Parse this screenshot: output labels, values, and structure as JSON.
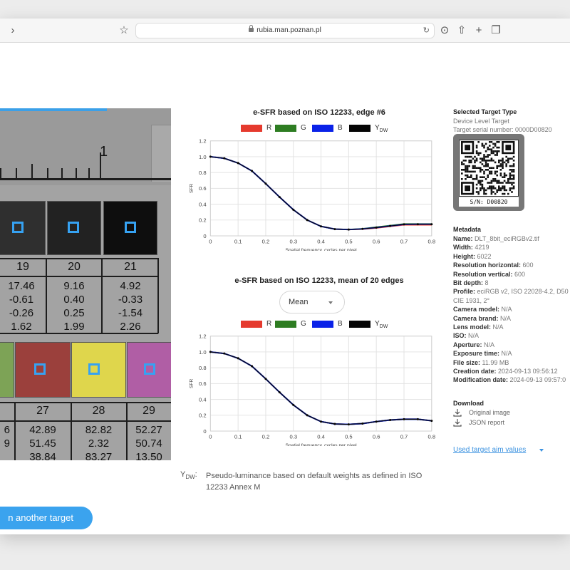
{
  "browser": {
    "url": "rubia.man.poznan.pl",
    "back_icon": "chevron-right-icon"
  },
  "target_image": {
    "ruler_label": "1",
    "row1": {
      "numbers": [
        "19",
        "20",
        "21"
      ],
      "values": [
        [
          "17.46",
          "-0.61",
          "-0.26",
          "1.62"
        ],
        [
          "9.16",
          "0.40",
          "0.25",
          "1.99"
        ],
        [
          "4.92",
          "-0.33",
          "-1.54",
          "2.26"
        ]
      ],
      "colors": [
        "#2f2f2f",
        "#222222",
        "#0e0e0e"
      ]
    },
    "row2": {
      "numbers": [
        "27",
        "28",
        "29"
      ],
      "first_partial": [
        "6",
        "9"
      ],
      "values": [
        [
          "42.89",
          "51.45",
          "38.84"
        ],
        [
          "82.82",
          "2.32",
          "83.27"
        ],
        [
          "52.27",
          "50.74",
          "13.50"
        ]
      ],
      "colors": [
        "#7da356",
        "#9b403c",
        "#dfd64c",
        "#b05ea5"
      ]
    }
  },
  "chart1": {
    "title": "e-SFR based on ISO 12233, edge #6"
  },
  "chart2": {
    "title": "e-SFR based on ISO 12233, mean of 20 edges",
    "dropdown_value": "Mean"
  },
  "legend": {
    "r": "R",
    "g": "G",
    "b": "B",
    "y": "Y",
    "y_sub": "DW",
    "colors": {
      "r": "#e53a2e",
      "g": "#2e7d22",
      "b": "#0a22e8",
      "y": "#050505"
    }
  },
  "chart_data": [
    {
      "type": "line",
      "title": "e-SFR based on ISO 12233, edge #6",
      "xlabel": "Spatial frequency, cycles per pixel",
      "ylabel": "SFR",
      "xlim": [
        0,
        0.8
      ],
      "ylim": [
        0,
        1.2
      ],
      "xticks": [
        "0",
        "0.1",
        "0.2",
        "0.3",
        "0.4",
        "0.5",
        "0.6",
        "0.7",
        "0.8"
      ],
      "yticks": [
        "0",
        "0.2",
        "0.4",
        "0.6",
        "0.8",
        "1.0",
        "1.2"
      ],
      "grid": true,
      "x": [
        0,
        0.05,
        0.1,
        0.15,
        0.2,
        0.25,
        0.3,
        0.35,
        0.4,
        0.45,
        0.5,
        0.55,
        0.6,
        0.65,
        0.7,
        0.75,
        0.8
      ],
      "series": [
        {
          "name": "R",
          "values": [
            1.0,
            0.98,
            0.92,
            0.82,
            0.66,
            0.49,
            0.33,
            0.2,
            0.12,
            0.085,
            0.08,
            0.085,
            0.1,
            0.12,
            0.14,
            0.14,
            0.14
          ]
        },
        {
          "name": "G",
          "values": [
            1.0,
            0.98,
            0.92,
            0.82,
            0.66,
            0.49,
            0.33,
            0.2,
            0.12,
            0.085,
            0.08,
            0.09,
            0.11,
            0.13,
            0.15,
            0.15,
            0.15
          ]
        },
        {
          "name": "B",
          "values": [
            1.0,
            0.98,
            0.92,
            0.82,
            0.66,
            0.49,
            0.33,
            0.2,
            0.12,
            0.085,
            0.08,
            0.088,
            0.105,
            0.125,
            0.145,
            0.147,
            0.147
          ]
        },
        {
          "name": "YDW",
          "values": [
            1.0,
            0.98,
            0.92,
            0.82,
            0.66,
            0.49,
            0.33,
            0.2,
            0.12,
            0.085,
            0.08,
            0.088,
            0.105,
            0.125,
            0.145,
            0.147,
            0.147
          ]
        }
      ]
    },
    {
      "type": "line",
      "title": "e-SFR based on ISO 12233, mean of 20 edges",
      "xlabel": "Spatial frequency, cycles per pixel",
      "ylabel": "SFR",
      "xlim": [
        0,
        0.8
      ],
      "ylim": [
        0,
        1.2
      ],
      "xticks": [
        "0",
        "0.1",
        "0.2",
        "0.3",
        "0.4",
        "0.5",
        "0.6",
        "0.7",
        "0.8"
      ],
      "yticks": [
        "0",
        "0.2",
        "0.4",
        "0.6",
        "0.8",
        "1.0",
        "1.2"
      ],
      "grid": true,
      "x": [
        0,
        0.05,
        0.1,
        0.15,
        0.2,
        0.25,
        0.3,
        0.35,
        0.4,
        0.45,
        0.5,
        0.55,
        0.6,
        0.65,
        0.7,
        0.75,
        0.8
      ],
      "series": [
        {
          "name": "R",
          "values": [
            1.0,
            0.98,
            0.92,
            0.82,
            0.66,
            0.49,
            0.33,
            0.2,
            0.12,
            0.09,
            0.085,
            0.095,
            0.12,
            0.14,
            0.15,
            0.15,
            0.13
          ]
        },
        {
          "name": "G",
          "values": [
            1.0,
            0.98,
            0.92,
            0.82,
            0.66,
            0.49,
            0.33,
            0.2,
            0.12,
            0.09,
            0.085,
            0.095,
            0.12,
            0.14,
            0.15,
            0.15,
            0.13
          ]
        },
        {
          "name": "B",
          "values": [
            1.0,
            0.98,
            0.92,
            0.82,
            0.66,
            0.49,
            0.33,
            0.2,
            0.12,
            0.09,
            0.085,
            0.095,
            0.12,
            0.14,
            0.15,
            0.15,
            0.13
          ]
        },
        {
          "name": "YDW",
          "values": [
            1.0,
            0.98,
            0.92,
            0.82,
            0.66,
            0.49,
            0.33,
            0.2,
            0.12,
            0.09,
            0.085,
            0.095,
            0.12,
            0.14,
            0.15,
            0.15,
            0.13
          ]
        }
      ]
    }
  ],
  "footnote": {
    "label": "Y",
    "label_sub": "DW",
    "text": "Pseudo-luminance based on default weights as defined in ISO 12233 Annex M"
  },
  "buttons": {
    "another_target": "n another target"
  },
  "panel": {
    "selected_heading": "Selected Target Type",
    "target_type": "Device Level Target",
    "serial": "Target serial number: 0000D00820",
    "qr_caption": "S/N: D00820",
    "metadata_heading": "Metadata",
    "fields": [
      {
        "k": "Name:",
        "v": "DLT_8bit_eciRGBv2.tif"
      },
      {
        "k": "Width:",
        "v": "4219"
      },
      {
        "k": "Height:",
        "v": "6022"
      },
      {
        "k": "Resolution horizontal:",
        "v": "600"
      },
      {
        "k": "Resolution vertical:",
        "v": "600"
      },
      {
        "k": "Bit depth:",
        "v": "8"
      },
      {
        "k": "Profile:",
        "v": "eciRGB v2, ISO 22028-4.2, D50"
      },
      {
        "k": "",
        "v": "CIE 1931, 2°"
      },
      {
        "k": "Camera model:",
        "v": "N/A"
      },
      {
        "k": "Camera brand:",
        "v": "N/A"
      },
      {
        "k": "Lens model:",
        "v": "N/A"
      },
      {
        "k": "ISO:",
        "v": "N/A"
      },
      {
        "k": "Aperture:",
        "v": "N/A"
      },
      {
        "k": "Exposure time:",
        "v": "N/A"
      },
      {
        "k": "File size:",
        "v": "11.99 MB"
      },
      {
        "k": "Creation date:",
        "v": "2024-09-13 09:56:12"
      },
      {
        "k": "Modification date:",
        "v": "2024-09-13 09:57:0"
      }
    ],
    "download_heading": "Download",
    "download_original": "Original image",
    "download_json": "JSON report",
    "aim_values": "Used target aim values"
  }
}
